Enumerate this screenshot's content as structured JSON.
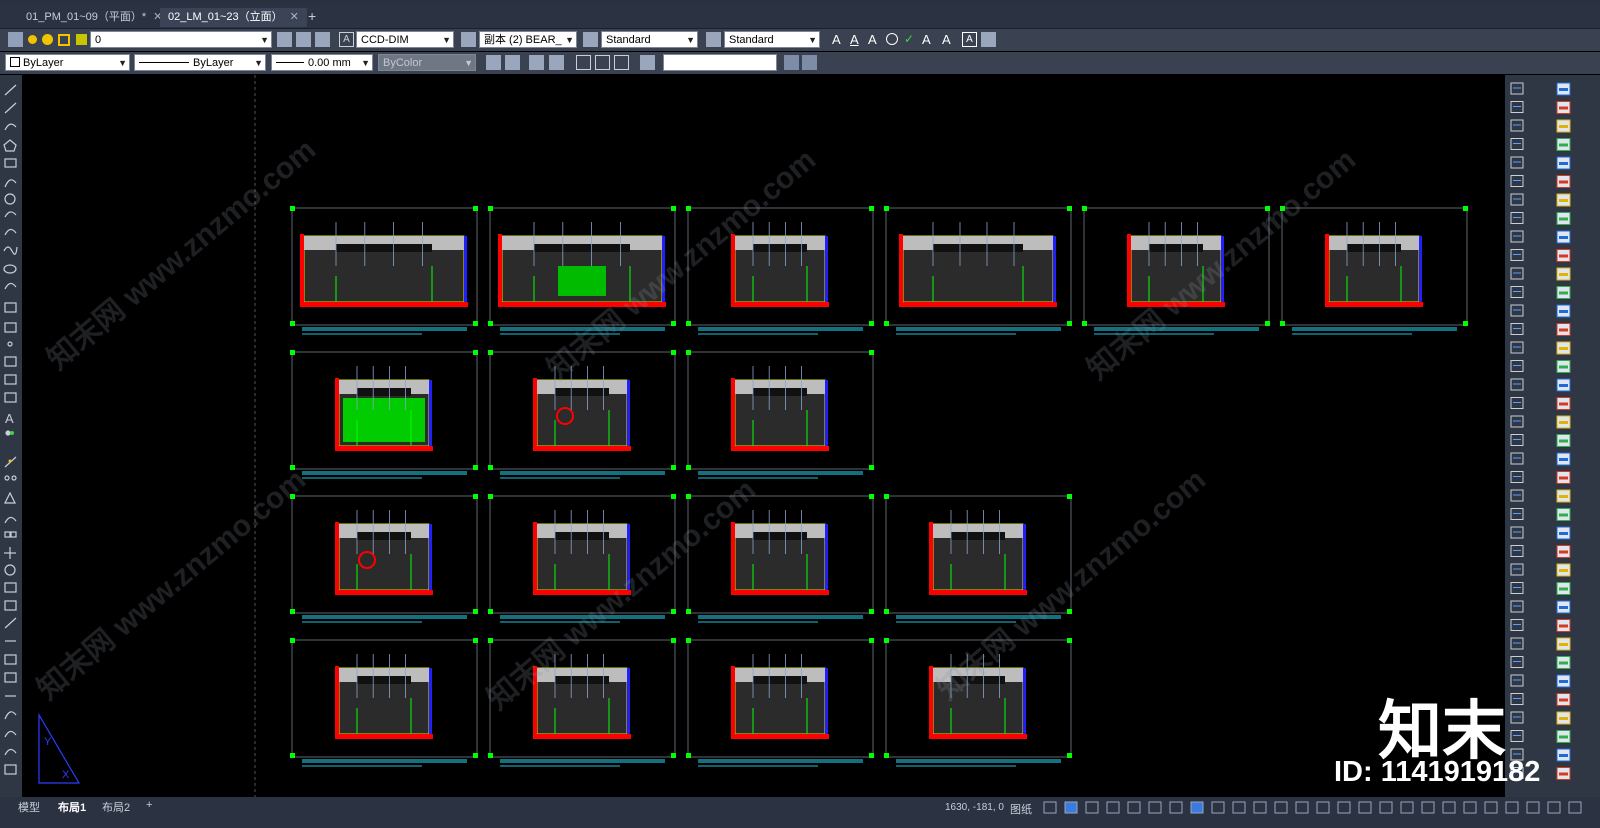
{
  "tabs": [
    {
      "label": "01_PM_01~09（平面）*"
    },
    {
      "label": "02_LM_01~23（立面）"
    }
  ],
  "toolbar1": {
    "layer_value": "0",
    "dim_style": "CCD-DIM",
    "multileader_style": "副本 (2) BEAR_",
    "table_style": "Standard",
    "text_style": "Standard"
  },
  "toolbar2": {
    "color": "ByLayer",
    "linetype": "ByLayer",
    "lineweight": "0.00 mm",
    "plotstyle": "ByColor",
    "search_value": ""
  },
  "status": {
    "layout_tabs": [
      "模型",
      "布局1",
      "布局2",
      "+"
    ],
    "coords": "1630, -181, 0",
    "paper": "图纸"
  },
  "watermark": {
    "text": "知末网 www.znzmo.com",
    "brand": "知末",
    "image_id": "ID: 1141919182"
  },
  "colors": {
    "bg": "#000000",
    "panel": "#2f3644",
    "accent_green": "#00ff00",
    "accent_red": "#ff0000"
  }
}
